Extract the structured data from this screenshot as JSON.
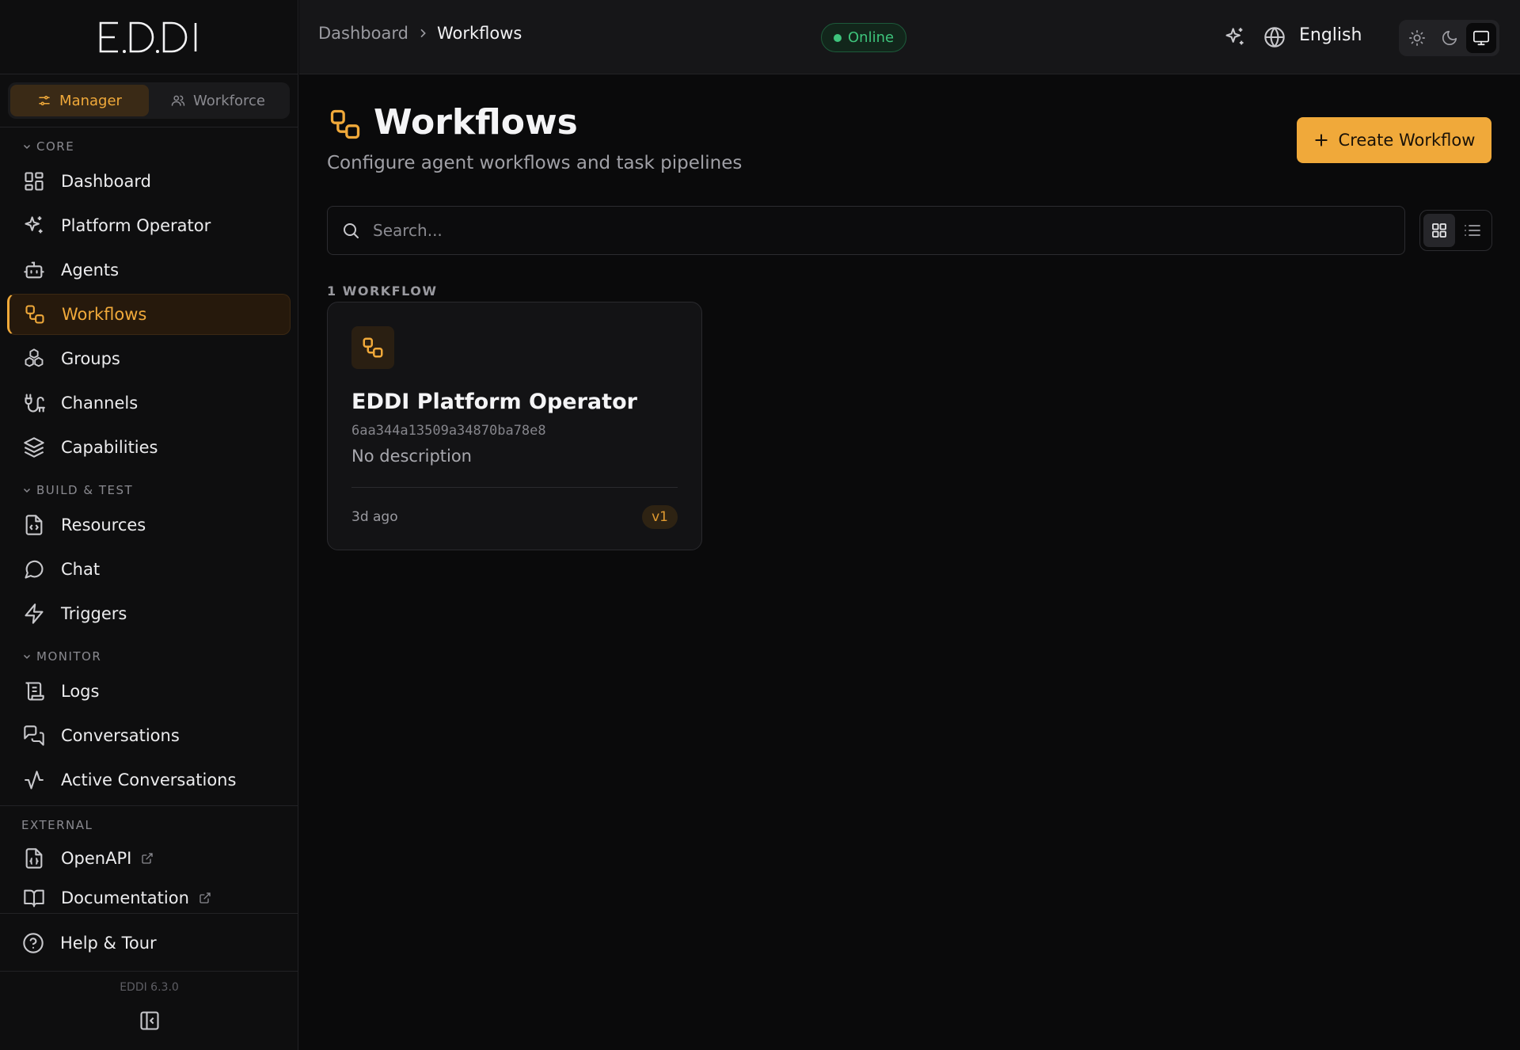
{
  "app": {
    "logo_text": "EDDI",
    "version": "EDDI 6.3.0"
  },
  "mode_switch": {
    "manager": "Manager",
    "workforce": "Workforce"
  },
  "sidebar": {
    "sections": {
      "core": "CORE",
      "build": "BUILD & TEST",
      "monitor": "MONITOR",
      "external": "EXTERNAL"
    },
    "items": {
      "dashboard": "Dashboard",
      "platform_operator": "Platform Operator",
      "agents": "Agents",
      "workflows": "Workflows",
      "groups": "Groups",
      "channels": "Channels",
      "capabilities": "Capabilities",
      "resources": "Resources",
      "chat": "Chat",
      "triggers": "Triggers",
      "logs": "Logs",
      "conversations": "Conversations",
      "active_conversations": "Active Conversations",
      "openapi": "OpenAPI",
      "documentation": "Documentation"
    },
    "help": "Help & Tour"
  },
  "header": {
    "breadcrumb": [
      "Dashboard",
      "Workflows"
    ],
    "status": "Online",
    "language": "English"
  },
  "main": {
    "title": "Workflows",
    "subtitle": "Configure agent workflows and task pipelines",
    "create_label": "Create Workflow",
    "search_placeholder": "Search...",
    "count_label": "1 WORKFLOW",
    "cards": [
      {
        "title": "EDDI Platform Operator",
        "id": "6aa344a13509a34870ba78e8",
        "description": "No description",
        "time": "3d ago",
        "version": "v1"
      }
    ]
  },
  "colors": {
    "accent": "#f0a93a",
    "background": "#0a0a0b",
    "online": "#3ec47c"
  }
}
